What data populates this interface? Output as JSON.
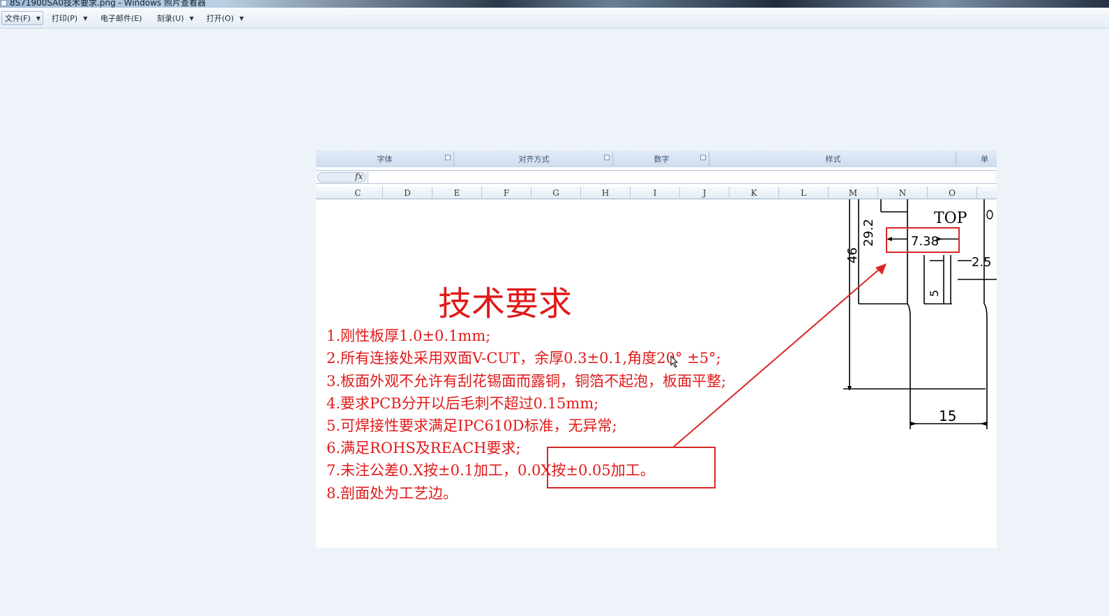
{
  "window": {
    "title": "8S71900SA0技术要求.png - Windows 照片查看器"
  },
  "menu": [
    {
      "label": "文件(F)",
      "has_caret": true
    },
    {
      "label": "打印(P)",
      "has_caret": true
    },
    {
      "label": "电子邮件(E)",
      "has_caret": false
    },
    {
      "label": "刻录(U)",
      "has_caret": true
    },
    {
      "label": "打开(O)",
      "has_caret": true
    }
  ],
  "image": {
    "ribbon_groups": [
      "字体",
      "对齐方式",
      "数字",
      "样式",
      "单"
    ],
    "formula_bar": {
      "fx": "fx"
    },
    "columns": [
      "C",
      "D",
      "E",
      "F",
      "G",
      "H",
      "I",
      "J",
      "K",
      "L",
      "M",
      "N",
      "O"
    ],
    "title": "技术要求",
    "requirements": [
      "1.刚性板厚1.0±0.1mm;",
      "2.所有连接处采用双面V-CUT，余厚0.3±0.1,角度20° ±5°;",
      "3.板面外观不允许有刮花锡面而露铜，铜箔不起泡，板面平整;",
      "4.要求PCB分开以后毛刺不超过0.15mm;",
      "5.可焊接性要求满足IPC610D标准，无异常;",
      "6.满足ROHS及REACH要求;",
      "7.未注公差0.X按±0.1加工，0.0X按±0.05加工。",
      "8.剖面处为工艺边。"
    ],
    "drawing": {
      "label_top": "TOP",
      "dim_width": "7.38",
      "dim_29": "29.2",
      "dim_46": "46",
      "dim_25": "2.5",
      "dim_5": "5",
      "dim_15": "15"
    },
    "colors": {
      "annotation": "#e01a1a",
      "highlight_box": "#d82626"
    }
  }
}
